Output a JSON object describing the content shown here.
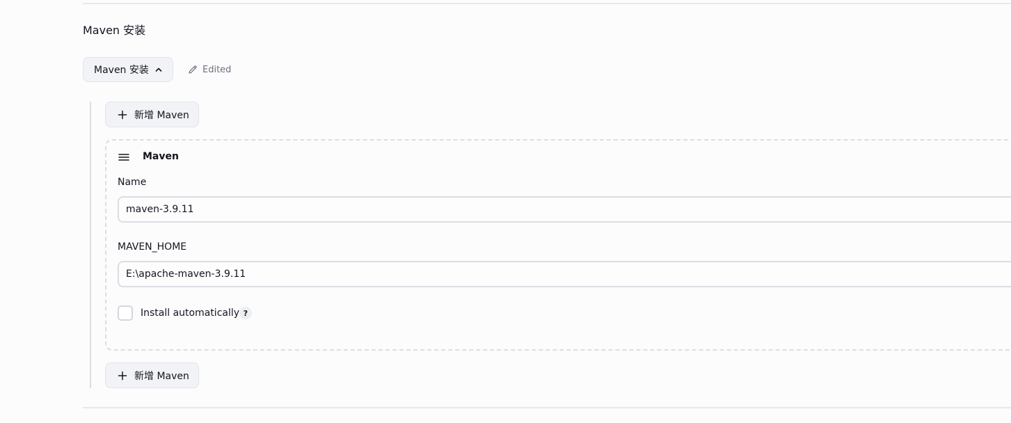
{
  "section": {
    "title": "Maven 安装",
    "collapse_button_label": "Maven 安装",
    "edited_label": "Edited"
  },
  "add_button_top_label": "新增 Maven",
  "add_button_bottom_label": "新增 Maven",
  "card": {
    "title": "Maven",
    "fields": {
      "name_label": "Name",
      "name_value": "maven-3.9.11",
      "home_label": "MAVEN_HOME",
      "home_value": "E:\\apache-maven-3.9.11"
    },
    "install_automatically": {
      "label": "Install automatically",
      "checked": false,
      "help_label": "?"
    }
  },
  "icons": {
    "collapse": "chevron-up-icon",
    "edited": "pencil-icon",
    "add": "plus-icon",
    "drag": "drag-handle-icon"
  }
}
